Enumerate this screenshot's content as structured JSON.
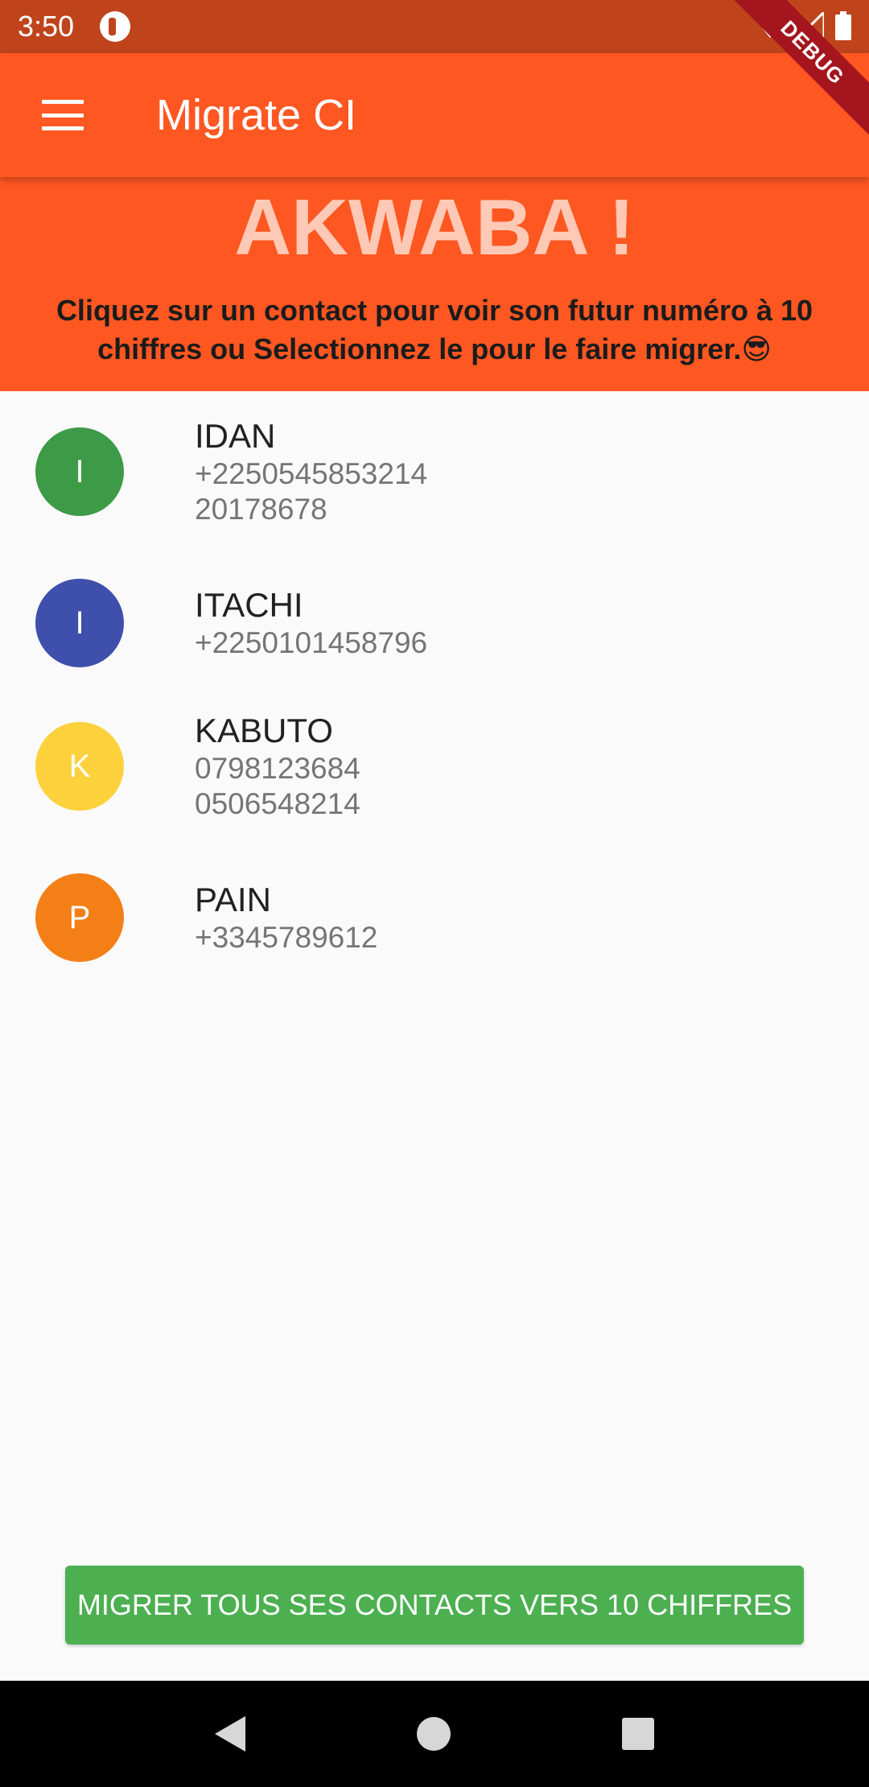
{
  "status_bar": {
    "time": "3:50"
  },
  "app_bar": {
    "title": "Migrate CI",
    "debug_label": "DEBUG"
  },
  "header": {
    "greeting": "AKWABA !",
    "message": "Cliquez sur un contact pour voir son futur numéro à 10 chiffres ou Selectionnez le pour le faire migrer.😎"
  },
  "contacts": [
    {
      "initial": "I",
      "name": "IDAN",
      "phones": [
        "+2250545853214",
        "20178678"
      ],
      "color": "#3d9a46"
    },
    {
      "initial": "I",
      "name": "ITACHI",
      "phones": [
        "+2250101458796"
      ],
      "color": "#3f4fac"
    },
    {
      "initial": "K",
      "name": "KABUTO",
      "phones": [
        "0798123684",
        "0506548214"
      ],
      "color": "#fdd13b"
    },
    {
      "initial": "P",
      "name": "PAIN",
      "phones": [
        "+3345789612"
      ],
      "color": "#f57f17"
    }
  ],
  "migrate_button": {
    "label": "MIGRER TOUS SES CONTACTS VERS 10 CHIFFRES"
  },
  "colors": {
    "primary": "#ff5722",
    "status_bar": "#bf441c",
    "button": "#4caf50"
  }
}
